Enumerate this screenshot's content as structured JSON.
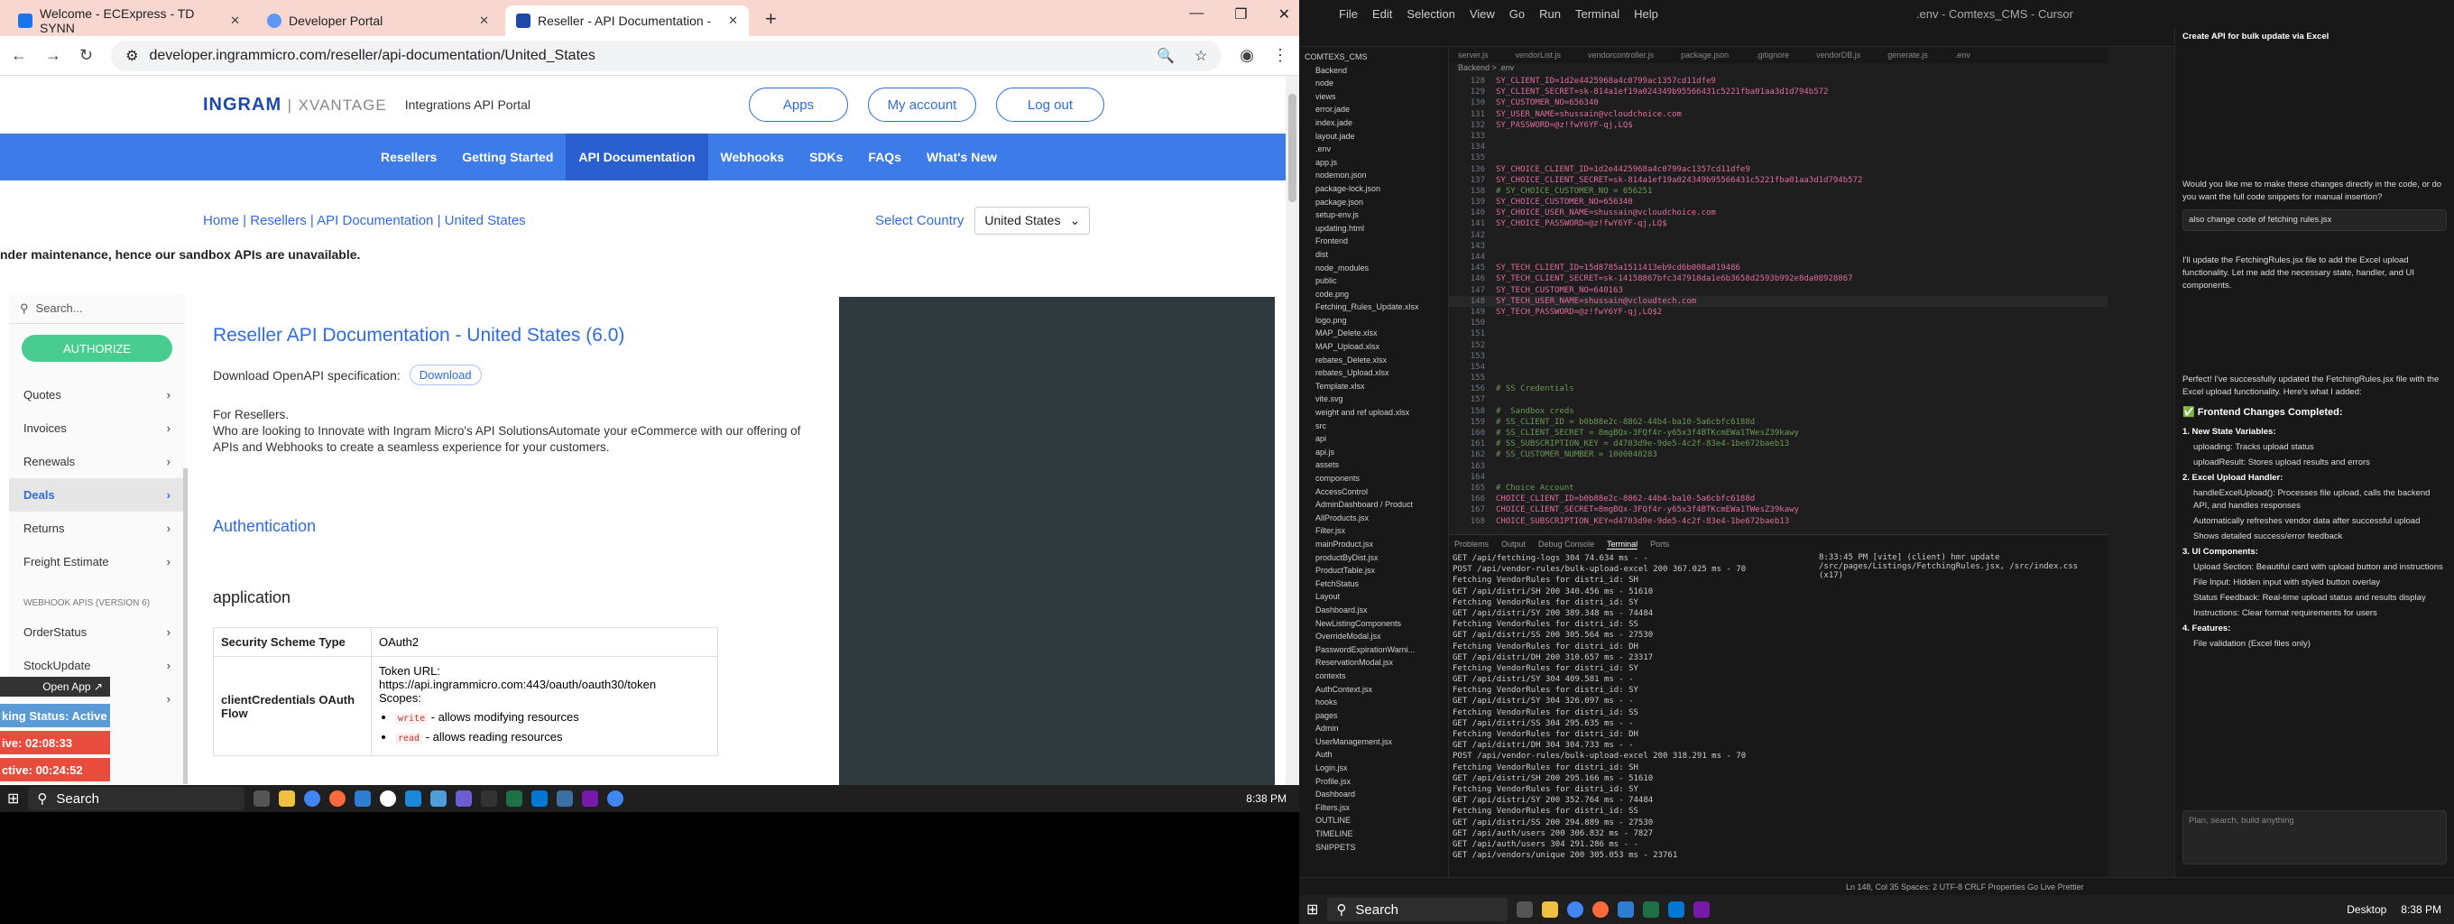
{
  "browser": {
    "tabs": [
      {
        "label": "Welcome - ECExpress - TD SYNN",
        "color": "#1a73e8"
      },
      {
        "label": "Developer Portal",
        "color": "#5e97f6"
      },
      {
        "label": "Reseller - API Documentation -",
        "color": "#1d4aa8"
      }
    ],
    "url": "developer.ingrammicro.com/reseller/api-documentation/United_States"
  },
  "site": {
    "logo_main": "INGRAM",
    "logo_sub": "XVANTAGE",
    "portal_title": "Integrations API Portal",
    "header_buttons": [
      "Apps",
      "My account",
      "Log out"
    ],
    "nav": [
      "Resellers",
      "Getting Started",
      "API Documentation",
      "Webhooks",
      "SDKs",
      "FAQs",
      "What's New"
    ],
    "breadcrumb": "Home | Resellers | API Documentation | United States",
    "country_label": "Select Country",
    "country_value": "United States",
    "notice": "nder maintenance, hence our sandbox APIs are unavailable."
  },
  "sidebar": {
    "search_placeholder": "Search...",
    "authorize": "AUTHORIZE",
    "items": [
      "Quotes",
      "Invoices",
      "Renewals",
      "Deals",
      "Returns",
      "Freight Estimate"
    ],
    "webhook_header": "WEBHOOK APIS (VERSION 6)",
    "webhook_items": [
      "OrderStatus",
      "StockUpdate"
    ]
  },
  "main": {
    "title": "Reseller API Documentation - United States (6.0)",
    "download_label": "Download OpenAPI specification:",
    "download_btn": "Download",
    "desc1": "For Resellers.",
    "desc2": "Who are looking to Innovate with Ingram Micro's API SolutionsAutomate your eCommerce with our offering of APIs and Webhooks to create a seamless experience for your customers.",
    "auth_heading": "Authentication",
    "app_heading": "application",
    "scheme_key": "Security Scheme Type",
    "scheme_val": "OAuth2",
    "flow_key": "clientCredentials OAuth Flow",
    "token_url": "Token URL: https://api.ingrammicro.com:443/oauth/oauth30/token",
    "scopes": "Scopes:",
    "scope1_code": "write",
    "scope1_text": " - allows modifying resources",
    "scope2_code": "read",
    "scope2_text": " - allows reading resources"
  },
  "overlays": {
    "open_app": "Open App ↗",
    "status": "king Status: Active",
    "timer1": "ive: 02:08:33",
    "timer2": "ctive: 00:24:52"
  },
  "taskbar": {
    "search": "Search",
    "time": "8:38 PM"
  },
  "cursor": {
    "menu": [
      "File",
      "Edit",
      "Selection",
      "View",
      "Go",
      "Run",
      "Terminal",
      "Help"
    ],
    "title": ".env - Comtexs_CMS - Cursor",
    "editor_tabs": [
      "server.js",
      "vendorList.js",
      "vendorcontroller.js",
      "package.json",
      ".gitignore",
      "vendorDB.js",
      "generate.js",
      ".env"
    ],
    "breadcrumb": "Backend > .env",
    "explorer": [
      "COMTEXS_CMS",
      "Backend",
      "node",
      "views",
      "error.jade",
      "index.jade",
      "layout.jade",
      ".env",
      "app.js",
      "nodemon.json",
      "package-lock.json",
      "package.json",
      "setup-env.js",
      "updating.html",
      "Frontend",
      "dist",
      "node_modules",
      "public",
      "code.png",
      "Fetching_Rules_Update.xlsx",
      "logo.png",
      "MAP_Delete.xlsx",
      "MAP_Upload.xlsx",
      "rebates_Delete.xlsx",
      "rebates_Upload.xlsx",
      "Template.xlsx",
      "vite.svg",
      "weight and ref upload.xlsx",
      "src",
      "api",
      "api.js",
      "assets",
      "components",
      "AccessControl",
      "AdminDashboard / Product",
      "AllProducts.jsx",
      "Filter.jsx",
      "mainProduct.jsx",
      "productByDist.jsx",
      "ProductTable.jsx",
      "FetchStatus",
      "Layout",
      "Dashboard.jsx",
      "NewListingComponents",
      "OverrideModal.jsx",
      "PasswordExpirationWarni...",
      "ReservationModal.jsx",
      "contexts",
      "AuthContext.jsx",
      "hooks",
      "pages",
      "Admin",
      "UserManagement.jsx",
      "Auth",
      "Login.jsx",
      "Profile.jsx",
      "Dashboard",
      "Filters.jsx",
      "OUTLINE",
      "TIMELINE",
      "SNIPPETS"
    ],
    "code": [
      {
        "n": "128",
        "t": "SY_CLIENT_ID=1d2e4425968a4c0799ac1357cd11dfe9",
        "c": "pink"
      },
      {
        "n": "129",
        "t": "SY_CLIENT_SECRET=sk-814a1ef19a024349b95566431c5221fba01aa3d1d794b572",
        "c": "pink"
      },
      {
        "n": "130",
        "t": "SY_CUSTOMER_NO=656340",
        "c": "pink"
      },
      {
        "n": "131",
        "t": "SY_USER_NAME=shussain@vcloudchoice.com",
        "c": "pink"
      },
      {
        "n": "132",
        "t": "SY_PASSWORD=@z!fwY6YF-qj,LQ$",
        "c": "pink"
      },
      {
        "n": "133",
        "t": "",
        "c": ""
      },
      {
        "n": "134",
        "t": "",
        "c": ""
      },
      {
        "n": "135",
        "t": "",
        "c": ""
      },
      {
        "n": "136",
        "t": "SY_CHOICE_CLIENT_ID=1d2e4425968a4c0799ac1357cd11dfe9",
        "c": "pink"
      },
      {
        "n": "137",
        "t": "SY_CHOICE_CLIENT_SECRET=sk-814a1ef19a024349b95566431c5221fba01aa3d1d794b572",
        "c": "pink"
      },
      {
        "n": "138",
        "t": "# SY_CHOICE_CUSTOMER_NO = 656251",
        "c": "grn"
      },
      {
        "n": "139",
        "t": "SY_CHOICE_CUSTOMER_NO=656340",
        "c": "pink"
      },
      {
        "n": "140",
        "t": "SY_CHOICE_USER_NAME=shussain@vcloudchoice.com",
        "c": "pink"
      },
      {
        "n": "141",
        "t": "SY_CHOICE_PASSWORD=@z!fwY6YF-qj,LQ$",
        "c": "pink"
      },
      {
        "n": "142",
        "t": "",
        "c": ""
      },
      {
        "n": "143",
        "t": "",
        "c": ""
      },
      {
        "n": "144",
        "t": "",
        "c": ""
      },
      {
        "n": "145",
        "t": "SY_TECH_CLIENT_ID=15d8785a1511413eb9cd6b008a819486",
        "c": "pink"
      },
      {
        "n": "146",
        "t": "SY_TECH_CLIENT_SECRET=sk-14158867bfc347918da1e6b3658d2593b992e8da08928867",
        "c": "pink"
      },
      {
        "n": "147",
        "t": "SY_TECH_CUSTOMER_NO=640163",
        "c": "pink"
      },
      {
        "n": "148",
        "t": "SY_TECH_USER_NAME=shussain@vcloudtech.com",
        "c": "pink"
      },
      {
        "n": "149",
        "t": "SY_TECH_PASSWORD=@z!fwY6YF-qj,LQ$2",
        "c": "pink"
      },
      {
        "n": "150",
        "t": "",
        "c": ""
      },
      {
        "n": "151",
        "t": "",
        "c": ""
      },
      {
        "n": "152",
        "t": "",
        "c": ""
      },
      {
        "n": "153",
        "t": "",
        "c": ""
      },
      {
        "n": "154",
        "t": "",
        "c": ""
      },
      {
        "n": "155",
        "t": "",
        "c": ""
      },
      {
        "n": "156",
        "t": "# SS Credentials",
        "c": "grn"
      },
      {
        "n": "157",
        "t": "",
        "c": ""
      },
      {
        "n": "158",
        "t": "#  Sandbox creds",
        "c": "grn"
      },
      {
        "n": "159",
        "t": "# SS_CLIENT_ID = b0b88e2c-8862-44b4-ba10-5a6cbfc6188d",
        "c": "grn"
      },
      {
        "n": "160",
        "t": "# SS_CLIENT_SECRET = 8mgBQx-3FQf4r-y65x3f4BTKcmEWa1TWesZ39kawy",
        "c": "grn"
      },
      {
        "n": "161",
        "t": "# SS_SUBSCRIPTION_KEY = d4703d9e-9de5-4c2f-83e4-1be672baeb13",
        "c": "grn"
      },
      {
        "n": "162",
        "t": "# SS_CUSTOMER_NUMBER = 1000040283",
        "c": "grn"
      },
      {
        "n": "163",
        "t": "",
        "c": ""
      },
      {
        "n": "164",
        "t": "",
        "c": ""
      },
      {
        "n": "165",
        "t": "# Choice Account",
        "c": "grn"
      },
      {
        "n": "166",
        "t": "CHOICE_CLIENT_ID=b0b88e2c-8862-44b4-ba10-5a6cbfc6188d",
        "c": "pink"
      },
      {
        "n": "167",
        "t": "CHOICE_CLIENT_SECRET=8mgBQx-3FQf4r-y65x3f4BTKcmEWa1TWesZ39kawy",
        "c": "pink"
      },
      {
        "n": "168",
        "t": "CHOICE_SUBSCRIPTION_KEY=d4703d9e-9de5-4c2f-83e4-1be672baeb13",
        "c": "pink"
      }
    ],
    "panel_tabs": [
      "Problems",
      "Output",
      "Debug Console",
      "Terminal",
      "Ports"
    ],
    "terminal": [
      "GET /api/fetching-logs 304 74.634 ms - -",
      "POST /api/vendor-rules/bulk-upload-excel 200 367.025 ms - 70",
      "Fetching VendorRules for distri_id: SH",
      "GET /api/distri/SH 200 340.456 ms - 51610",
      "Fetching VendorRules for distri_id: SY",
      "GET /api/distri/SY 200 389.348 ms - 74484",
      "Fetching VendorRules for distri_id: SS",
      "GET /api/distri/SS 200 305.564 ms - 27530",
      "Fetching VendorRules for distri_id: DH",
      "GET /api/distri/DH 200 310.657 ms - 23317",
      "Fetching VendorRules for distri_id: SY",
      "GET /api/distri/SY 304 409.581 ms - -",
      "Fetching VendorRules for distri_id: SY",
      "GET /api/distri/SY 304 326.097 ms - -",
      "Fetching VendorRules for distri_id: SS",
      "GET /api/distri/SS 304 295.635 ms - -",
      "Fetching VendorRules for distri_id: DH",
      "GET /api/distri/DH 304 304.733 ms - -",
      "POST /api/vendor-rules/bulk-upload-excel 200 318.291 ms - 70",
      "Fetching VendorRules for distri_id: SH",
      "GET /api/distri/SH 200 295.166 ms - 51610",
      "Fetching VendorRules for distri_id: SY",
      "GET /api/distri/SY 200 352.764 ms - 74484",
      "Fetching VendorRules for distri_id: SS",
      "GET /api/distri/SS 200 294.889 ms - 27530",
      "GET /api/auth/users 200 306.832 ms - 7827",
      "GET /api/auth/users 304 291.286 ms - -",
      "GET /api/vendors/unique 200 305.053 ms - 23761"
    ],
    "terminal2": "8:33:45 PM [vite] (client) hmr update /src/pages/Listings/FetchingRules.jsx, /src/index.css (x17)",
    "chat": {
      "title": "Create API for bulk update via Excel",
      "q1": "Would you like me to make these changes directly in the code, or do you want the full code snippets for manual insertion?",
      "user_msg": "also change code of fetching rules.jsx",
      "reply1": "I'll update the FetchingRules.jsx file to add the Excel upload functionality. Let me add the necessary state, handler, and UI components.",
      "reply2": "Perfect! I've successfully updated the FetchingRules.jsx file with the Excel upload functionality. Here's what I added:",
      "heading": "✅ Frontend Changes Completed:",
      "points": [
        "1. New State Variables:",
        "uploading: Tracks upload status",
        "uploadResult: Stores upload results and errors",
        "2. Excel Upload Handler:",
        "handleExcelUpload(): Processes file upload, calls the backend API, and handles responses",
        "Automatically refreshes vendor data after successful upload",
        "Shows detailed success/error feedback",
        "3. UI Components:",
        "Upload Section: Beautiful card with upload button and instructions",
        "File Input: Hidden input with styled button overlay",
        "Status Feedback: Real-time upload status and results display",
        "Instructions: Clear format requirements for users",
        "4. Features:",
        "File validation (Excel files only)"
      ],
      "input_placeholder": "Plan, search, build anything"
    },
    "status": "Ln 148, Col 35   Spaces: 2   UTF-8   CRLF   Properties   Go Live   Prettier",
    "taskbar_time": "8:38 PM",
    "desktop": "Desktop"
  }
}
